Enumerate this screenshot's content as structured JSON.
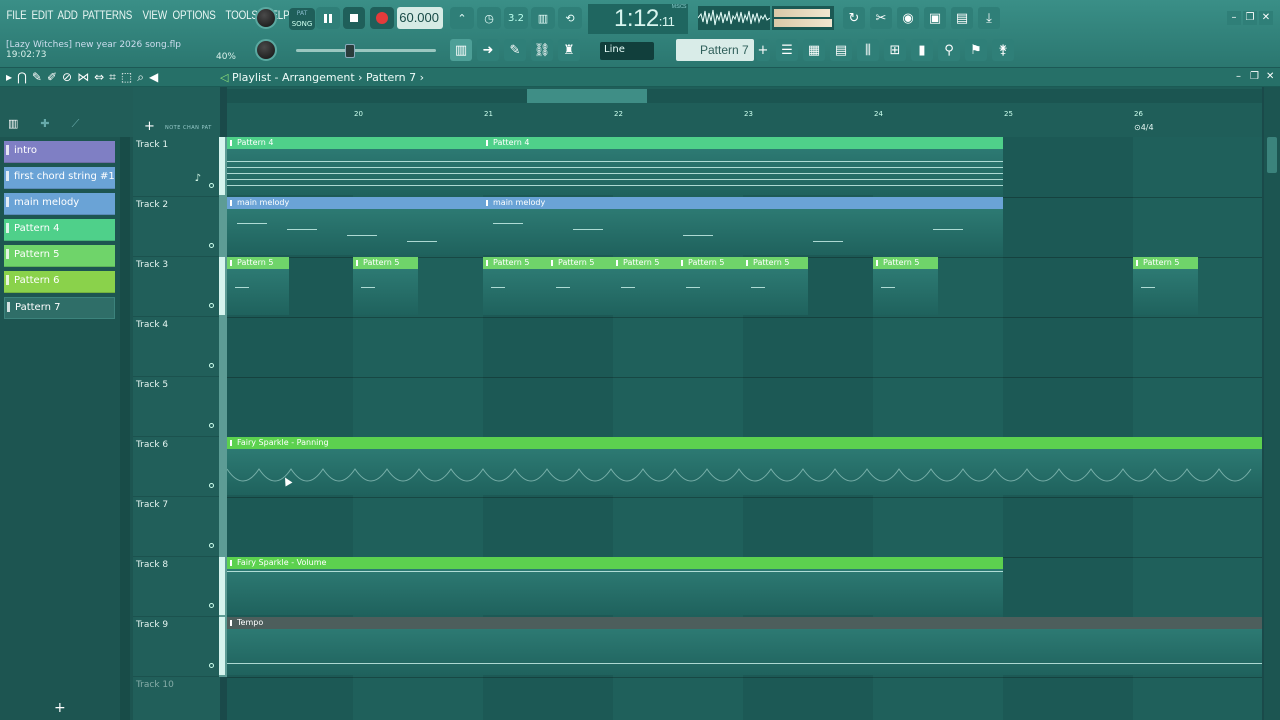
{
  "menu": [
    "FILE",
    "EDIT",
    "ADD",
    "PATTERNS",
    "VIEW",
    "OPTIONS",
    "TOOLS",
    "HELP"
  ],
  "transport": {
    "song_label": "SONG",
    "pat_label": "PAT",
    "tempo": "60.000",
    "time": "1:12",
    "time_small": ":11",
    "time_units": "M:S:CS",
    "mode_label": "3.2"
  },
  "project": {
    "name": "[Lazy Witches] new year 2026 song.flp",
    "clock": "19:02:73",
    "percent": "40%"
  },
  "snap": {
    "value": "Line"
  },
  "pattern_selector": {
    "value": "Pattern 7"
  },
  "playlist": {
    "title": "Playlist - Arrangement",
    "breadcrumb_sep": "›",
    "current_pattern": "Pattern 7",
    "header_labels": "NOTE  CHAN  PAT"
  },
  "picker": {
    "items": [
      {
        "label": "intro",
        "color": "#7f7fc4"
      },
      {
        "label": "first chord string #1",
        "color": "#6aa3d6"
      },
      {
        "label": "main melody",
        "color": "#6aa3d6"
      },
      {
        "label": "Pattern 4",
        "color": "#4fd08a"
      },
      {
        "label": "Pattern 5",
        "color": "#6fd46a"
      },
      {
        "label": "Pattern 6",
        "color": "#8ad24b"
      },
      {
        "label": "Pattern 7",
        "color": "#2f6e68"
      }
    ]
  },
  "ruler": {
    "bars": [
      "20",
      "21",
      "22",
      "23",
      "24",
      "25",
      "26"
    ],
    "time_signature": "4/4"
  },
  "tracks": [
    "Track 1",
    "Track 2",
    "Track 3",
    "Track 4",
    "Track 5",
    "Track 6",
    "Track 7",
    "Track 8",
    "Track 9",
    "Track 10"
  ],
  "clips": {
    "pattern4": "Pattern 4",
    "main_melody": "main melody",
    "pattern5": "Pattern 5",
    "panning": "Fairy Sparkle - Panning",
    "volume": "Fairy Sparkle - Volume",
    "tempo": "Tempo"
  },
  "colors": {
    "pattern4": "#4fd08a",
    "main_melody": "#6aa3d6",
    "pattern5": "#6fd46a",
    "automation": "#5cd14f",
    "tempo": "#4d5e5c"
  }
}
